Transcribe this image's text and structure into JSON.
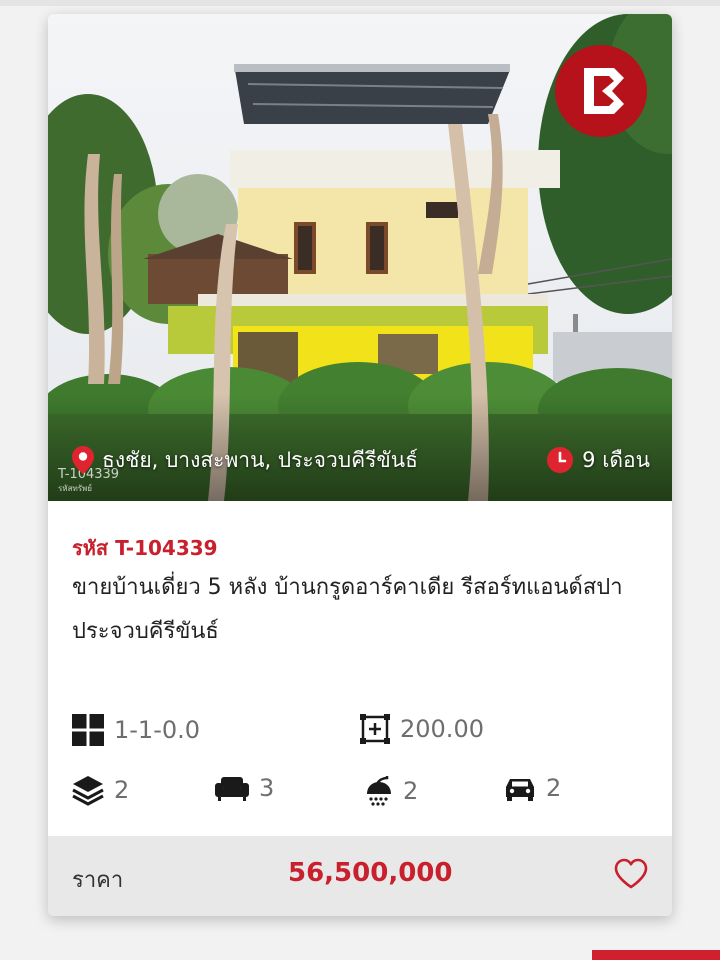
{
  "listing": {
    "code_label": "รหัส T-104339",
    "title": "ขายบ้านเดี่ยว 5 หลัง บ้านกรูดอาร์คาเดีย รีสอร์ทแอนด์สปา ประจวบคีรีขันธ์",
    "location": "ธงชัย, บางสะพาน, ประจวบคีรีขันธ์",
    "age": "9 เดือน",
    "watermark_code": "T-104339",
    "watermark_sub": "รหัสทรัพย์",
    "specs": {
      "land_area": "1-1-0.0",
      "usable_area": "200.00",
      "floors": "2",
      "living_rooms": "3",
      "bathrooms": "2",
      "parking": "2"
    },
    "price_label": "ราคา",
    "price": "56,500,000"
  },
  "icons": {
    "logo": "brand-logo-icon",
    "location": "map-pin-icon",
    "age": "clock-icon",
    "land": "grid-icon",
    "area": "area-expand-icon",
    "floors": "layers-icon",
    "living": "sofa-icon",
    "bath": "shower-icon",
    "parking": "car-icon",
    "favorite": "heart-icon"
  },
  "colors": {
    "accent": "#c8202c",
    "price_bar": "#e8e8e8",
    "text": "#222222",
    "muted": "#6e6e6e"
  }
}
